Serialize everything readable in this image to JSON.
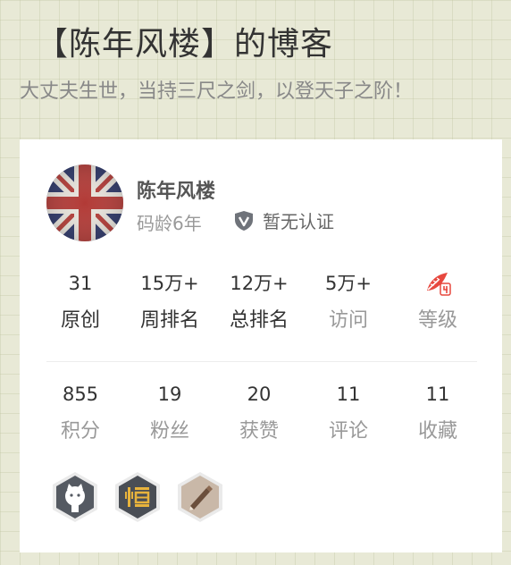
{
  "header": {
    "title": "【陈年风楼】的博客",
    "subtitle": "大丈夫生世，当持三尺之剑，以登天子之阶！"
  },
  "profile": {
    "name": "陈年风楼",
    "code_age": "码龄6年",
    "certification": "暂无认证",
    "certification_icon": "shield-v-icon",
    "avatar_icon": "union-jack-avatar"
  },
  "stats_row1": [
    {
      "value": "31",
      "label": "原创"
    },
    {
      "value": "15万+",
      "label": "周排名"
    },
    {
      "value": "12万+",
      "label": "总排名"
    },
    {
      "value": "5万+",
      "label": "访问"
    },
    {
      "value": "",
      "label": "等级"
    }
  ],
  "stats_row2": [
    {
      "value": "855",
      "label": "积分"
    },
    {
      "value": "19",
      "label": "粉丝"
    },
    {
      "value": "20",
      "label": "获赞"
    },
    {
      "value": "11",
      "label": "评论"
    },
    {
      "value": "11",
      "label": "收藏"
    }
  ],
  "level_icon": "level-feather-icon",
  "badges": [
    "github-badge-icon",
    "zhihu-badge-icon",
    "pen-badge-icon"
  ],
  "colors": {
    "background": "#e8e9d6",
    "level_red": "#e7483f",
    "badge_dark": "#555a62",
    "badge_light": "#c9b8a8"
  }
}
